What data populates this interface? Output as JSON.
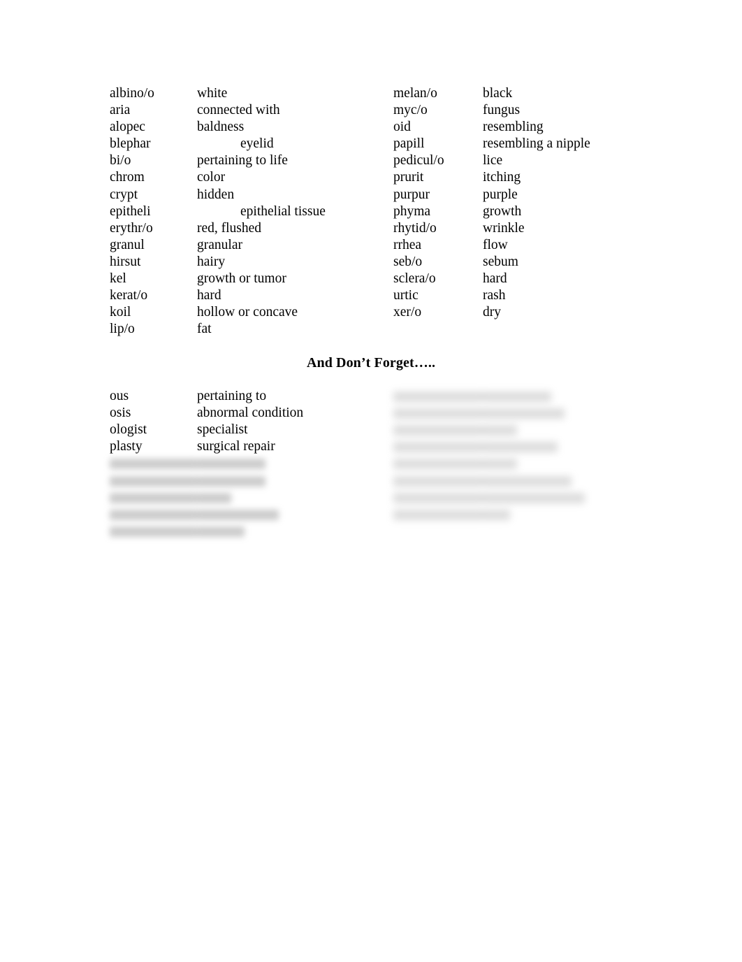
{
  "document": {
    "title": "Medical Terminology Word Parts",
    "background_color": "#ffffff",
    "text_color": "#000000"
  },
  "glossary_top": {
    "left_column": [
      {
        "term": "albino/o",
        "meaning": "white",
        "indented": false
      },
      {
        "term": "aria",
        "meaning": "connected with",
        "indented": false
      },
      {
        "term": "alopec",
        "meaning": "baldness",
        "indented": false
      },
      {
        "term": "blephar",
        "meaning": "eyelid",
        "indented": true
      },
      {
        "term": "bi/o",
        "meaning": "pertaining to life",
        "indented": false
      },
      {
        "term": "chrom",
        "meaning": "color",
        "indented": false
      },
      {
        "term": "crypt",
        "meaning": "hidden",
        "indented": false
      },
      {
        "term": "epitheli",
        "meaning": "epithelial tissue",
        "indented": true
      },
      {
        "term": "erythr/o",
        "meaning": "red, flushed",
        "indented": false
      },
      {
        "term": "granul",
        "meaning": "granular",
        "indented": false
      },
      {
        "term": "hirsut",
        "meaning": "hairy",
        "indented": false
      },
      {
        "term": "kel",
        "meaning": "growth or tumor",
        "indented": false
      },
      {
        "term": "kerat/o",
        "meaning": "hard",
        "indented": false
      },
      {
        "term": "koil",
        "meaning": "hollow or concave",
        "indented": false
      },
      {
        "term": "lip/o",
        "meaning": "fat",
        "indented": false
      }
    ],
    "right_column": [
      {
        "term": "melan/o",
        "meaning": "black",
        "indented": false
      },
      {
        "term": "myc/o",
        "meaning": "fungus",
        "indented": false
      },
      {
        "term": "oid",
        "meaning": "resembling",
        "indented": false
      },
      {
        "term": "papill",
        "meaning": "resembling a nipple",
        "indented": false
      },
      {
        "term": "pedicul/o",
        "meaning": "lice",
        "indented": false
      },
      {
        "term": "prurit",
        "meaning": "itching",
        "indented": false
      },
      {
        "term": "purpur",
        "meaning": "purple",
        "indented": false
      },
      {
        "term": "phyma",
        "meaning": "growth",
        "indented": false
      },
      {
        "term": "rhytid/o",
        "meaning": "wrinkle",
        "indented": false
      },
      {
        "term": "rrhea",
        "meaning": "flow",
        "indented": false
      },
      {
        "term": "seb/o",
        "meaning": "sebum",
        "indented": false
      },
      {
        "term": "sclera/o",
        "meaning": "hard",
        "indented": false
      },
      {
        "term": "urtic",
        "meaning": "rash",
        "indented": false
      },
      {
        "term": "xer/o",
        "meaning": "dry",
        "indented": false
      }
    ]
  },
  "section_heading": {
    "label": "And Don’t Forget….."
  },
  "glossary_bottom": {
    "left_column": [
      {
        "term": "ous",
        "meaning": "pertaining to",
        "blurred": false
      },
      {
        "term": "osis",
        "meaning": "abnormal condition",
        "blurred": false
      },
      {
        "term": "ologist",
        "meaning": "specialist",
        "blurred": false
      },
      {
        "term": "plasty",
        "meaning": "surgical repair",
        "blurred": false
      },
      {
        "term": "    ",
        "meaning": "          ",
        "blurred": true
      },
      {
        "term": "  ",
        "meaning": "          ",
        "blurred": true
      },
      {
        "term": "      ",
        "meaning": "     ",
        "blurred": true
      },
      {
        "term": "   ",
        "meaning": "            ",
        "blurred": true
      },
      {
        "term": "  ",
        "meaning": "       ",
        "blurred": true
      }
    ],
    "right_column": [
      {
        "term": "   ",
        "meaning": "          ",
        "blurred": true
      },
      {
        "term": "  ",
        "meaning": "            ",
        "blurred": true
      },
      {
        "term": "    ",
        "meaning": "     ",
        "blurred": true
      },
      {
        "term": "  ",
        "meaning": "           ",
        "blurred": true
      },
      {
        "term": "    ",
        "meaning": "     ",
        "blurred": true
      },
      {
        "term": "    ",
        "meaning": "             ",
        "blurred": true
      },
      {
        "term": "       ",
        "meaning": "               ",
        "blurred": true
      },
      {
        "term": "   ",
        "meaning": "    ",
        "blurred": true
      }
    ]
  }
}
